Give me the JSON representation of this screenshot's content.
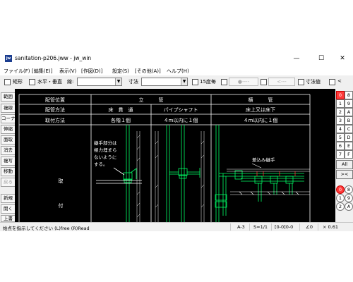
{
  "window": {
    "title": "sanitation-p206.jww - jw_win",
    "icon_label": "jw",
    "minimize": "—",
    "maximize": "☐",
    "close": "✕"
  },
  "menu": [
    "ファイル(F)",
    "[編集(E)]",
    "表示(V)",
    "[作図(D)]",
    "設定(S)",
    "[その他(A)]",
    "ヘルプ(H)"
  ],
  "toolbar": {
    "rect_label": "矩形",
    "hv_label": "水平・垂直",
    "type_label": "線:",
    "dim_label": "寸法",
    "deg15_label": "15度毎",
    "arrow_label": "<---",
    "dimval_label": "寸法値",
    "lt_label": "<"
  },
  "left_tools": [
    "範囲",
    "複線",
    "コーナー",
    "伸縮",
    "面取",
    "消去",
    "複写",
    "移動",
    "戻る",
    "新規",
    "開く",
    "上書"
  ],
  "right_tools": {
    "layer_groups_top": [
      "0",
      "8",
      "1",
      "9",
      "2",
      "A",
      "3",
      "B",
      "4",
      "C",
      "5",
      "D",
      "6",
      "E",
      "7",
      "F"
    ],
    "all_label": "All",
    "swap_label": "><",
    "layers_bottom": [
      "0",
      "8",
      "1",
      "9",
      "2",
      "A"
    ],
    "selected_top": "0",
    "selected_bottom": "0"
  },
  "drawing": {
    "header": {
      "col0_row0": "配管位置",
      "col1_row0": "立　　　管",
      "col3_row0": "横　　　管",
      "col0_row1": "配管方法",
      "col1_row1": "床　貫　通",
      "col2_row1": "パイプシャフト",
      "col3_row1": "床上又は床下",
      "col0_row2": "取付方法",
      "col1_row2": "各階１個",
      "col2_row2": "４m以内に１個",
      "col3_row2": "４m以内に１個"
    },
    "side_label_1": "取",
    "side_label_2": "付",
    "note_lines": [
      "継手部分は",
      "極力埋まら",
      "ないように",
      "する。"
    ],
    "annotation": "差込み継手"
  },
  "status": {
    "message": "始点を指示してください (L)free (R)Read",
    "paper": "A-3",
    "scale": "S=1/1",
    "layer": "[0-0]0-0",
    "angle": "∠0",
    "zoom": "× 0.61"
  },
  "colors": {
    "canvas_bg": "#000000",
    "pipe": "#00ff66",
    "grid": "#ffffff",
    "text": "#ffffff",
    "selected": "#ff3b3b"
  }
}
